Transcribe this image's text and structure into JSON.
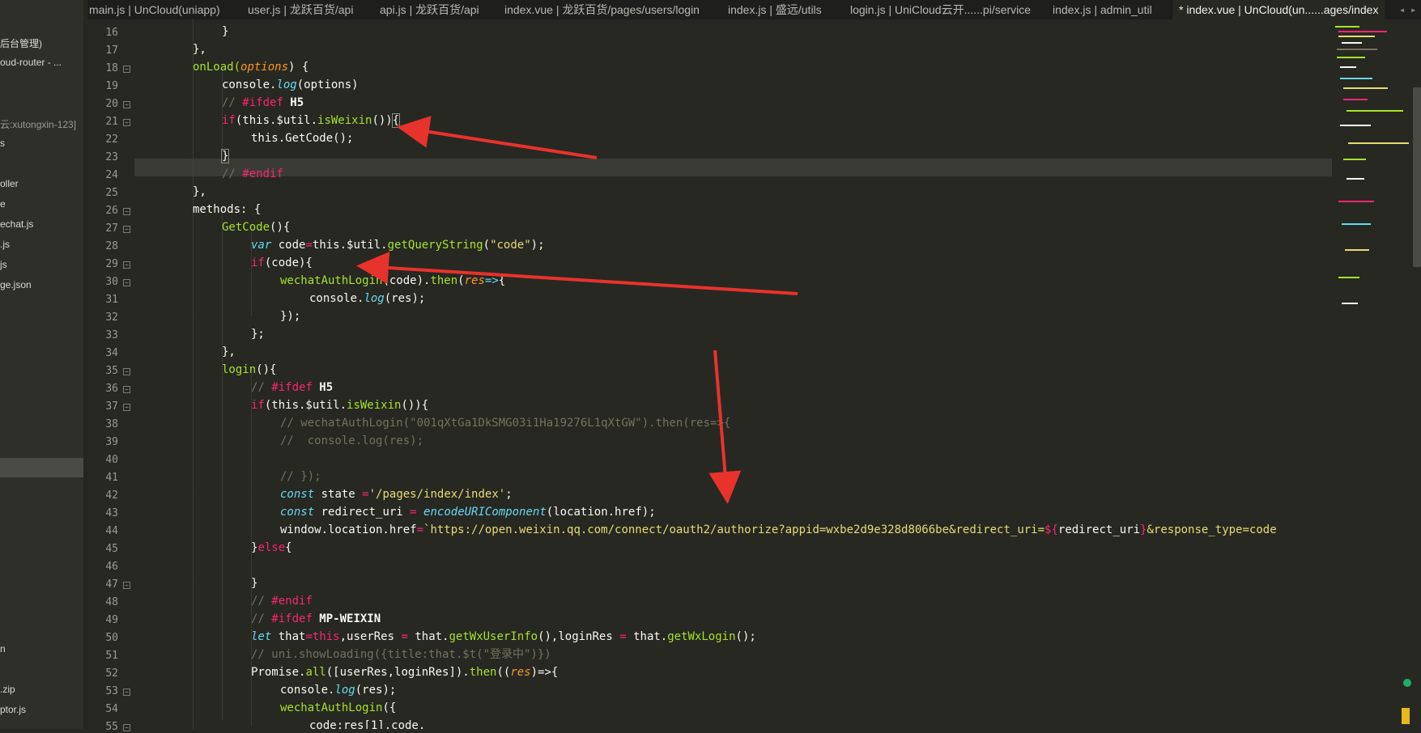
{
  "tabs": [
    {
      "label": "main.js | UnCloud(uniapp)",
      "active": false
    },
    {
      "label": "user.js | 龙跃百货/api",
      "active": false
    },
    {
      "label": "api.js | 龙跃百货/api",
      "active": false
    },
    {
      "label": "index.vue | 龙跃百货/pages/users/login",
      "active": false
    },
    {
      "label": "index.js | 盛远/utils",
      "active": false
    },
    {
      "label": "login.js | UniCloud云开......pi/service",
      "active": false
    },
    {
      "label": "index.js | admin_util",
      "active": false
    },
    {
      "label": "* index.vue | UnCloud(un......ages/index",
      "active": true
    }
  ],
  "tab_nav": {
    "prev": "◂",
    "next": "▸"
  },
  "sidebar": {
    "items": [
      "后台管理)",
      "oud-router - ...",
      "云:xutongxin-123]",
      "s",
      "oller",
      "e",
      "echat.js",
      ".js",
      "js",
      "ge.json",
      "n",
      ".zip",
      "ptor.js"
    ]
  },
  "line_numbers": [
    "16",
    "17",
    "18",
    "19",
    "20",
    "21",
    "22",
    "23",
    "24",
    "25",
    "26",
    "27",
    "28",
    "29",
    "30",
    "31",
    "32",
    "33",
    "34",
    "35",
    "36",
    "37",
    "38",
    "39",
    "40",
    "41",
    "42",
    "43",
    "44",
    "45",
    "46",
    "47",
    "48",
    "49",
    "50",
    "51",
    "52",
    "53",
    "54",
    "55"
  ],
  "code": {
    "l16": "}",
    "l17": "},",
    "l18_a": "onLoad(",
    "l18_b": "options",
    "l18_c": ") {",
    "l19_a": "console.",
    "l19_b": "log",
    "l19_c": "(options)",
    "l20_a": "// ",
    "l20_b": "#ifdef",
    "l20_c": " H5",
    "l21_a": "if",
    "l21_b": "(this.$util.",
    "l21_c": "isWeixin",
    "l21_d": "())",
    "l21_e": "{",
    "l22_a": "this.",
    "l22_b": "GetCode",
    "l22_c": "();",
    "l23": "}",
    "l24_a": "// ",
    "l24_b": "#endif",
    "l25": "},",
    "l26": "methods: {",
    "l27_a": "GetCode",
    "l27_b": "(){",
    "l28_a": "var",
    "l28_b": " code",
    "l28_c": "=",
    "l28_d": "this.$util.",
    "l28_e": "getQueryString",
    "l28_f": "(",
    "l28_g": "\"code\"",
    "l28_h": ");",
    "l29_a": "if",
    "l29_b": "(code){",
    "l30_a": "wechatAuthLogin",
    "l30_b": "(code).",
    "l30_c": "then",
    "l30_d": "(",
    "l30_e": "res",
    "l30_f": "=>",
    "l30_g": "{",
    "l31_a": "console.",
    "l31_b": "log",
    "l31_c": "(res);",
    "l32": "});",
    "l33": "};",
    "l34": "},",
    "l35_a": "login",
    "l35_b": "(){",
    "l36_a": "// ",
    "l36_b": "#ifdef",
    "l36_c": " H5",
    "l37_a": "if",
    "l37_b": "(this.$util.",
    "l37_c": "isWeixin",
    "l37_d": "()){",
    "l38": "// wechatAuthLogin(\"001qXtGa1DkSMG03i1Ha19276L1qXtGW\").then(res=>{",
    "l39": "//  console.log(res);",
    "l40": "",
    "l41": "// });",
    "l42_a": "const",
    "l42_b": " state ",
    "l42_c": "=",
    "l42_d": "'/pages/index/index'",
    "l42_e": ";",
    "l43_a": "const",
    "l43_b": " redirect_uri ",
    "l43_c": "=",
    "l43_d": " ",
    "l43_e": "encodeURIComponent",
    "l43_f": "(location.href);",
    "l44_a": "window.location.href",
    "l44_b": "=",
    "l44_c": "`https://open.weixin.qq.com/connect/oauth2/authorize?appid=wxbe2d9e328d8066be&redirect_uri=",
    "l44_d": "${",
    "l44_e": "redirect_uri",
    "l44_f": "}",
    "l44_g": "&response_type=code",
    "l45_a": "}",
    "l45_b": "else",
    "l45_c": "{",
    "l46": "",
    "l47": "}",
    "l48_a": "// ",
    "l48_b": "#endif",
    "l49_a": "// ",
    "l49_b": "#ifdef",
    "l49_c": " MP-WEIXIN",
    "l50_a": "let",
    "l50_b": " that",
    "l50_c": "=",
    "l50_d": "this",
    "l50_e": ",userRes ",
    "l50_f": "=",
    "l50_g": " that.",
    "l50_h": "getWxUserInfo",
    "l50_i": "(),loginRes ",
    "l50_j": "=",
    "l50_k": " that.",
    "l50_l": "getWxLogin",
    "l50_m": "();",
    "l51": "// uni.showLoading({title:that.$t(\"登录中\")})",
    "l52_a": "Promise.",
    "l52_b": "all",
    "l52_c": "([userRes,loginRes]).",
    "l52_d": "then",
    "l52_e": "((",
    "l52_f": "res",
    "l52_g": ")=>{",
    "l53_a": "console.",
    "l53_b": "log",
    "l53_c": "(res);",
    "l54_a": "wechatAuthLogin",
    "l54_b": "({",
    "l55": "code:res[1].code,"
  },
  "colors": {
    "background": "#272822",
    "keyword": "#f92672",
    "function": "#a6e22e",
    "string": "#e6db74",
    "comment": "#75715e",
    "param": "#fd971f",
    "storage": "#66d9ef",
    "arrow": "#e8322c"
  }
}
